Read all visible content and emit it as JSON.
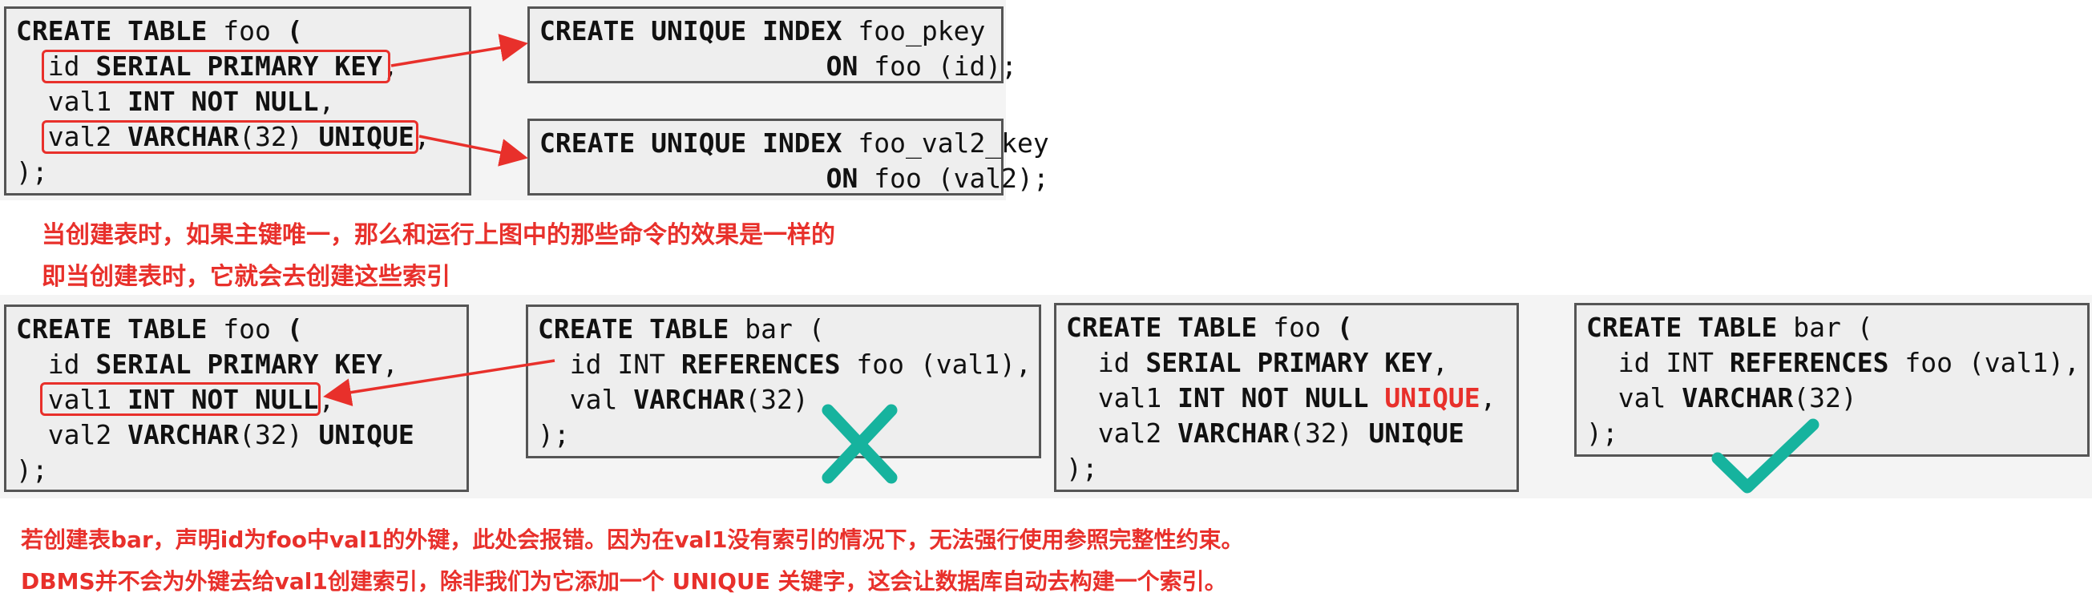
{
  "top": {
    "create_foo": {
      "l1": [
        "CREATE TABLE",
        " foo ",
        "("
      ],
      "l2_pre": "  ",
      "l2": [
        "id ",
        "SERIAL PRIMARY KEY"
      ],
      "l2_end": ",",
      "l3": [
        "  val1 ",
        "INT NOT NULL",
        ","
      ],
      "l4_pre": "  ",
      "l4": [
        "val2 ",
        "VARCHAR",
        "(32) ",
        "UNIQUE"
      ],
      "l4_end": ",",
      "l5": ");"
    },
    "index_pkey": {
      "l1": [
        "CREATE UNIQUE INDEX",
        " foo_pkey"
      ],
      "l2": [
        "                  ",
        "ON",
        " foo (id);"
      ]
    },
    "index_val2": {
      "l1": [
        "CREATE UNIQUE INDEX",
        " foo_val2_key"
      ],
      "l2": [
        "                  ",
        "ON",
        " foo (val2);"
      ]
    },
    "notes": [
      "当创建表时，如果主键唯一，那么和运行上图中的那些命令的效果是一样的",
      "即当创建表时，它就会去创建这些索引"
    ]
  },
  "bottom": {
    "foo_a": {
      "l1": [
        "CREATE TABLE",
        " foo ",
        "("
      ],
      "l2": [
        "  id ",
        "SERIAL PRIMARY KEY",
        ","
      ],
      "l3_pre": "  ",
      "l3": [
        "val1 ",
        "INT NOT NULL"
      ],
      "l3_end": ",",
      "l4": [
        "  val2 ",
        "VARCHAR",
        "(32) ",
        "UNIQUE"
      ],
      "l5": ");"
    },
    "bar_a": {
      "l1": [
        "CREATE TABLE",
        " bar ("
      ],
      "l2": [
        "  id INT ",
        "REFERENCES",
        " foo (val1),"
      ],
      "l3": [
        "  val ",
        "VARCHAR",
        "(32)"
      ],
      "l4": ");"
    },
    "foo_b": {
      "l1": [
        "CREATE TABLE",
        " foo ",
        "("
      ],
      "l2": [
        "  id ",
        "SERIAL PRIMARY KEY",
        ","
      ],
      "l3": [
        "  val1 ",
        "INT NOT NULL",
        " ",
        "UNIQUE",
        ","
      ],
      "l4": [
        "  val2 ",
        "VARCHAR",
        "(32) ",
        "UNIQUE"
      ],
      "l5": ");"
    },
    "bar_b": {
      "l1": [
        "CREATE TABLE",
        " bar ("
      ],
      "l2": [
        "  id INT ",
        "REFERENCES",
        " foo (val1),"
      ],
      "l3": [
        "  val ",
        "VARCHAR",
        "(32)"
      ],
      "l4": ");"
    },
    "notes": [
      "若创建表bar，声明id为foo中val1的外键，此处会报错。因为在val1没有索引的情况下，无法强行使用参照完整性约束。",
      "DBMS并不会为外键去给val1创建索引，除非我们为它添加一个 UNIQUE 关键字，这会让数据库自动去构建一个索引。"
    ]
  },
  "colors": {
    "accent_red": "#e8302b",
    "mark_teal": "#16b39e",
    "box_fill": "#eeeeee",
    "box_border": "#555555"
  },
  "icons": [
    "cross-icon",
    "check-icon",
    "arrow-icon"
  ]
}
